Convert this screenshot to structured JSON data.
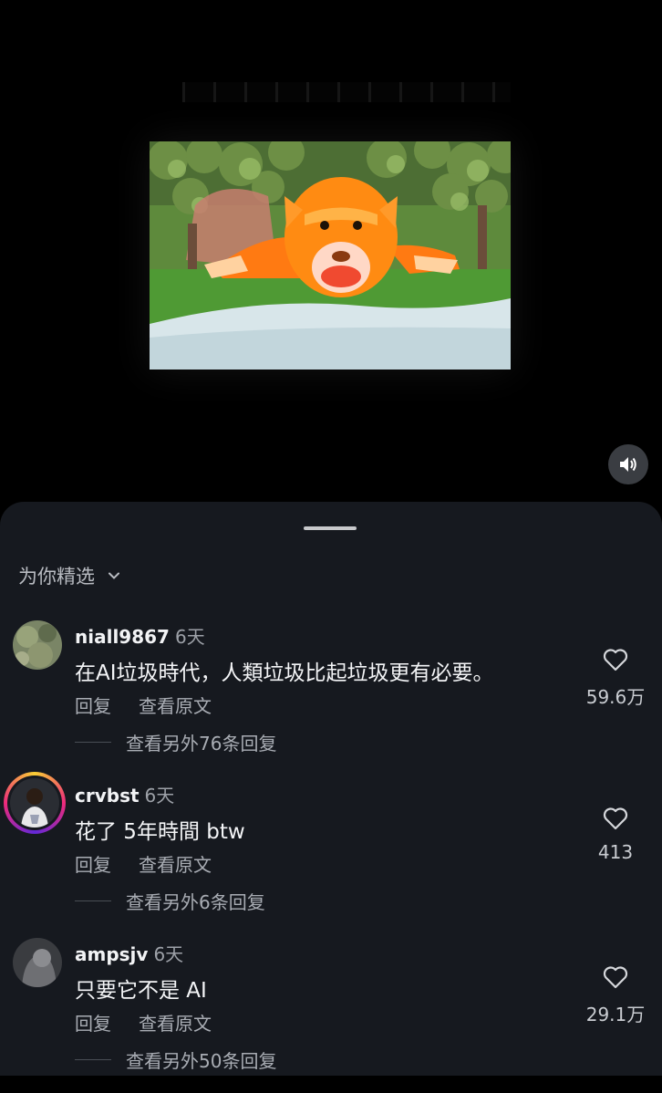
{
  "video": {
    "mute_icon": "speaker-icon"
  },
  "sheet": {
    "filter_label": "为你精选",
    "filter_icon": "chevron-down-icon"
  },
  "comments": [
    {
      "username": "niall9867",
      "time": "6天",
      "text": "在AI垃圾時代，人類垃圾比起垃圾更有必要。",
      "reply_label": "回复",
      "view_original_label": "查看原文",
      "more_replies": "查看另外76条回复",
      "likes": "59.6万"
    },
    {
      "username": "crvbst",
      "time": "6天",
      "text": "花了 5年時間 btw",
      "reply_label": "回复",
      "view_original_label": "查看原文",
      "more_replies": "查看另外6条回复",
      "likes": "413"
    },
    {
      "username": "ampsjv",
      "time": "6天",
      "text": "只要它不是 AI",
      "reply_label": "回复",
      "view_original_label": "查看原文",
      "more_replies": "查看另外50条回复",
      "likes": "29.1万"
    }
  ]
}
